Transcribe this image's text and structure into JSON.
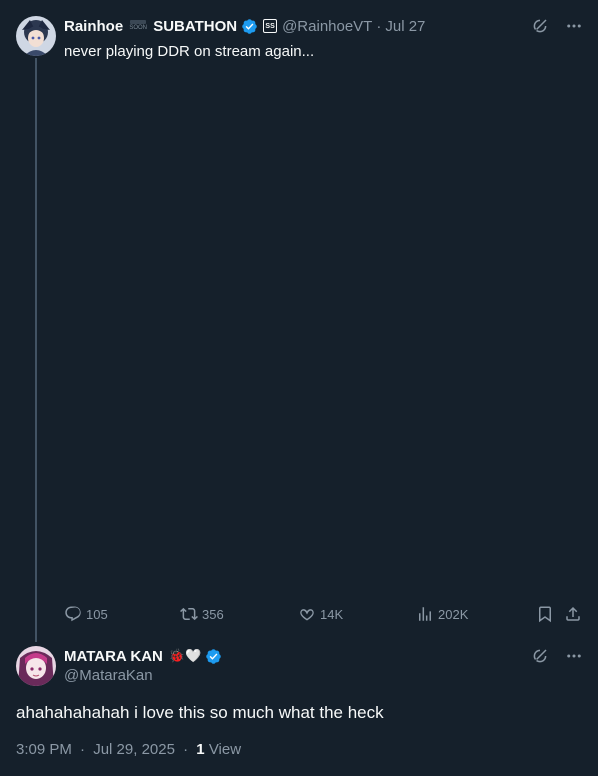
{
  "parent_tweet": {
    "display_name": "Rainhoe",
    "badge_text": "SOON",
    "display_name_suffix": "SUBATHON",
    "affiliate_badge": "SS",
    "handle": "@RainhoeVT",
    "separator": "·",
    "date": "Jul 27",
    "text": "never playing DDR on stream again...",
    "stats": {
      "replies": "105",
      "retweets": "356",
      "likes": "14K",
      "views": "202K"
    }
  },
  "reply_tweet": {
    "display_name": "MATARA KAN",
    "emojis": "🐞🤍",
    "handle": "@MataraKan",
    "text": "ahahahahahah i love this so much what the heck",
    "time": "3:09 PM",
    "separator": "·",
    "date": "Jul 29, 2025",
    "views_count": "1",
    "views_label": "View"
  },
  "colors": {
    "background": "#15202b",
    "text_primary": "#f7f9f9",
    "text_secondary": "#8b98a5",
    "verified_blue": "#1d9bf0",
    "thread_line": "#425364"
  },
  "icons": {
    "grok": "grok-icon",
    "more": "more-icon",
    "reply": "reply-icon",
    "retweet": "retweet-icon",
    "like": "heart-icon",
    "views": "views-icon",
    "bookmark": "bookmark-icon",
    "share": "share-icon",
    "verified": "verified-icon"
  }
}
